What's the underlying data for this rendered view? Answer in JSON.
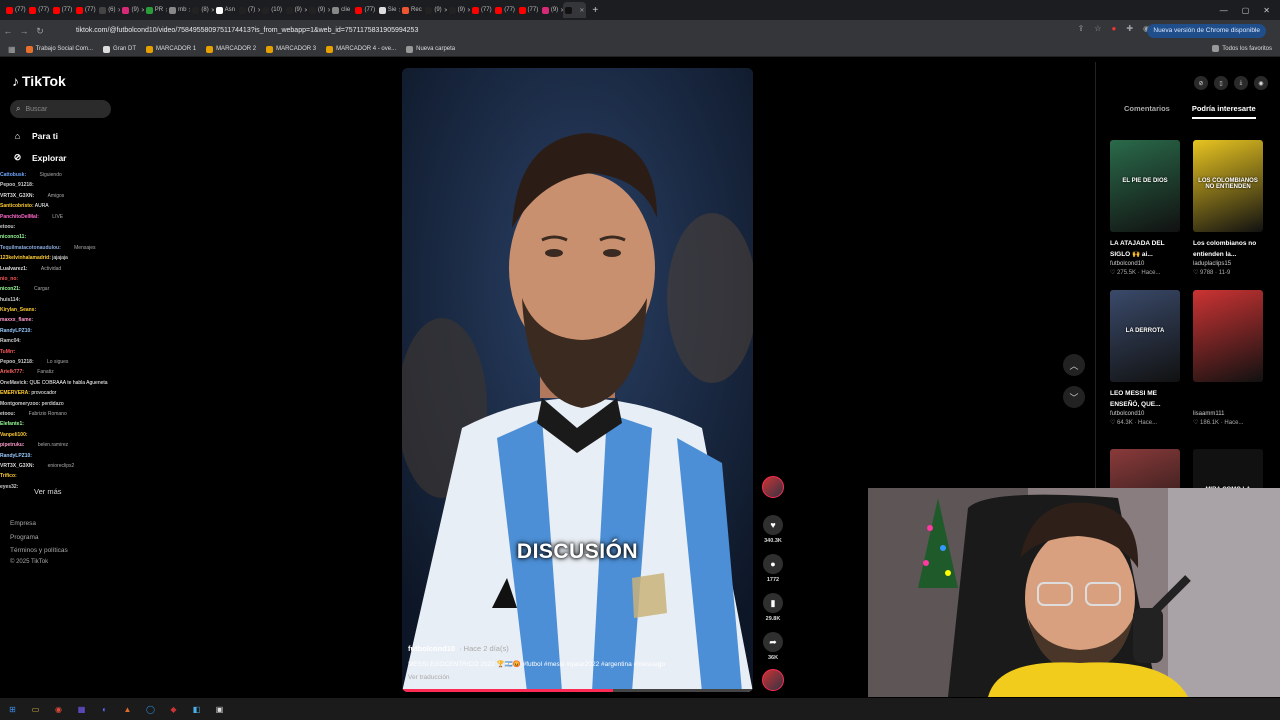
{
  "browser": {
    "tabs": [
      {
        "label": "(77)",
        "color": "#ff0000"
      },
      {
        "label": "(77)",
        "color": "#ff0000"
      },
      {
        "label": "(77)",
        "color": "#ff0000"
      },
      {
        "label": "(77)",
        "color": "#ff0000"
      },
      {
        "label": "(6)",
        "color": "#444"
      },
      {
        "label": "(9)",
        "color": "#d62976"
      },
      {
        "label": "PR",
        "color": "#2a9d3a"
      },
      {
        "label": "mb",
        "color": "#888"
      },
      {
        "label": "(8)",
        "color": "#222"
      },
      {
        "label": "Asn",
        "color": "#fff"
      },
      {
        "label": "(7)",
        "color": "#222"
      },
      {
        "label": "(10)",
        "color": "#222"
      },
      {
        "label": "(9)",
        "color": "#222"
      },
      {
        "label": "(9)",
        "color": "#222"
      },
      {
        "label": "clie",
        "color": "#888"
      },
      {
        "label": "(77)",
        "color": "#ff0000"
      },
      {
        "label": "Sie",
        "color": "#ddd"
      },
      {
        "label": "Rec",
        "color": "#e53"
      },
      {
        "label": "(9)",
        "color": "#222"
      },
      {
        "label": "(9)",
        "color": "#222"
      },
      {
        "label": "(77)",
        "color": "#ff0000"
      },
      {
        "label": "(77)",
        "color": "#ff0000"
      },
      {
        "label": "(77)",
        "color": "#ff0000"
      },
      {
        "label": "(9)",
        "color": "#d62976"
      },
      {
        "label": "",
        "color": "#111",
        "active": true
      }
    ],
    "url": "tiktok.com/@futbolcond10/video/7584955809751174413?is_from_webapp=1&web_id=7571175831905994253",
    "update_label": "Nueva versión de Chrome disponible",
    "bookmarks": [
      {
        "label": "Trabajo Social Com...",
        "color": "#e8702a"
      },
      {
        "label": "Gran DT",
        "color": "#ddd"
      },
      {
        "label": "MARCADOR 1",
        "color": "#e6a100"
      },
      {
        "label": "MARCADOR 2",
        "color": "#e6a100"
      },
      {
        "label": "MARCADOR 3",
        "color": "#e6a100"
      },
      {
        "label": "MARCADOR 4 - ove...",
        "color": "#e6a100"
      },
      {
        "label": "Nueva carpeta",
        "color": "#999"
      }
    ],
    "all_bookmarks": "Todos los favoritos"
  },
  "sidebar": {
    "brand": "TikTok",
    "search_placeholder": "Buscar",
    "nav": [
      {
        "label": "Para ti",
        "icon": "home-icon"
      },
      {
        "label": "Explorar",
        "icon": "compass-icon"
      }
    ],
    "footer": [
      "Empresa",
      "Programa",
      "Términos y políticas",
      "© 2025 TikTok"
    ],
    "see_more": "Ver más"
  },
  "chat": [
    {
      "user": "Cattobusk:",
      "msg": "",
      "color": "#6fa8ff",
      "under": "Siguiendo"
    },
    {
      "user": "Pepoo_91218:",
      "msg": "",
      "color": "#ccc"
    },
    {
      "user": "VRT3X_G3XN:",
      "msg": "",
      "color": "#ddd",
      "under": "Amigos"
    },
    {
      "user": "Santicobristo:",
      "msg": "AURA",
      "color": "#ffcc33"
    },
    {
      "user": "PanchitoDelMal:",
      "msg": "",
      "color": "#ff66cc",
      "under": "LIVE"
    },
    {
      "user": "etoou:",
      "msg": "",
      "color": "#ccc"
    },
    {
      "user": "niconco11:",
      "msg": "",
      "color": "#9f9"
    },
    {
      "user": "Tequilmatacotonaudulou:",
      "msg": "",
      "color": "#8ad",
      "under": "Mensajes"
    },
    {
      "user": "123kelvinhalamadrid:",
      "msg": "jajajaja",
      "color": "#ffcc33"
    },
    {
      "user": "Lualvarez1:",
      "msg": "",
      "color": "#ddd",
      "under": "Actividad"
    },
    {
      "user": "nio_no:",
      "msg": "",
      "color": "#f55"
    },
    {
      "user": "nicon21:",
      "msg": "",
      "color": "#9f9",
      "under": "Cargar"
    },
    {
      "user": "huis114:",
      "msg": "",
      "color": "#ccc"
    },
    {
      "user": "Kirylan_Seans:",
      "msg": "",
      "color": "#fc3"
    },
    {
      "user": "maxxx_flame:",
      "msg": "",
      "color": "#f9c"
    },
    {
      "user": "RandyLPZ10:",
      "msg": "",
      "color": "#9cf"
    },
    {
      "user": "Ramc04:",
      "msg": "",
      "color": "#ccc"
    },
    {
      "user": "TuMrr:",
      "msg": "",
      "color": "#f55"
    },
    {
      "user": "Pepoo_91218:",
      "msg": "",
      "color": "#ccc",
      "under": "Lo sigues"
    },
    {
      "user": "Arielk777:",
      "msg": "",
      "color": "#f66",
      "under": "Fanatiz"
    },
    {
      "user": "OneMavick:",
      "msg": "QUE COBRAAA te habla Agueneta",
      "color": "#ccc"
    },
    {
      "user": "EMERVERA:",
      "msg": "provocador",
      "color": "#ffcc33"
    },
    {
      "user": "Montgomeryzoo:",
      "msg": "perdidazo",
      "color": "#ccc"
    },
    {
      "user": "etoou:",
      "msg": "",
      "color": "#ccc",
      "under": "Fabrizio Romano"
    },
    {
      "user": "Elefante1:",
      "msg": "",
      "color": "#9f9"
    },
    {
      "user": "Vanpeli100:",
      "msg": "",
      "color": "#fc3"
    },
    {
      "user": "pipetruku:",
      "msg": "",
      "color": "#f9c",
      "under": "belen.ramirez"
    },
    {
      "user": "RandyLPZ10:",
      "msg": "",
      "color": "#9cf"
    },
    {
      "user": "VRT3X_G3XN:",
      "msg": "",
      "color": "#ddd",
      "under": "enioreclips2"
    },
    {
      "user": "Trifico:",
      "msg": "",
      "color": "#fc3"
    },
    {
      "user": "eyes32:",
      "msg": "",
      "color": "#ccc"
    }
  ],
  "video": {
    "caption": "DISCUSIÓN",
    "author": "futbolcond10",
    "time": "· Hace 2 día(s)",
    "description": "MESSI EGOCENTRICO 2022 🏆🇦🇷😡 #futbol #messi #qatar2022 #argentina #messiego",
    "translate": "Ver traducción",
    "progress": 0.6,
    "actions": [
      {
        "name": "like",
        "icon": "heart-icon",
        "glyph": "♥",
        "count": "340.3K"
      },
      {
        "name": "comment",
        "icon": "comment-icon",
        "glyph": "●",
        "count": "1772"
      },
      {
        "name": "save",
        "icon": "bookmark-icon",
        "glyph": "▮",
        "count": "29.8K"
      },
      {
        "name": "share",
        "icon": "share-icon",
        "glyph": "➦",
        "count": "36K"
      }
    ]
  },
  "right_panel": {
    "tabs": [
      "Comentarios",
      "Podría interesarte"
    ],
    "active_tab": "Podría interesarte",
    "cards": [
      {
        "title": "LA ATAJADA DEL SIGLO 🙌 ai...",
        "user": "futbolcond10",
        "meta": "♡ 275.5K · Hace...",
        "thumb_text": "EL PIE DE DIOS",
        "bg": "#2a6a4a"
      },
      {
        "title": "Los colombianos no entienden la...",
        "user": "laduplaclips15",
        "meta": "♡ 9788 · 11-9",
        "thumb_text": "LOS COLOMBIANOS NO ENTIENDEN",
        "bg": "#e8c420"
      },
      {
        "title": "LEO MESSI ME ENSEÑÓ, QUE...",
        "user": "futbolcond10",
        "meta": "♡ 64.3K · Hace...",
        "thumb_text": "LA DERROTA",
        "bg": "#3a4a6a"
      },
      {
        "title": "",
        "user": "lisaamm111",
        "meta": "♡ 186.1K · Hace...",
        "thumb_text": "",
        "bg": "#c33"
      },
      {
        "title": "",
        "user": "",
        "meta": "",
        "thumb_text": "",
        "bg": "#8a3a3a"
      },
      {
        "title": "",
        "user": "",
        "meta": "",
        "thumb_text": "MIRA COMO LA DUERME",
        "bg": "#111"
      }
    ]
  },
  "taskbar": [
    "windows",
    "explorer",
    "chrome",
    "app1",
    "app2",
    "app3",
    "app4",
    "app5",
    "app6",
    "app7"
  ]
}
